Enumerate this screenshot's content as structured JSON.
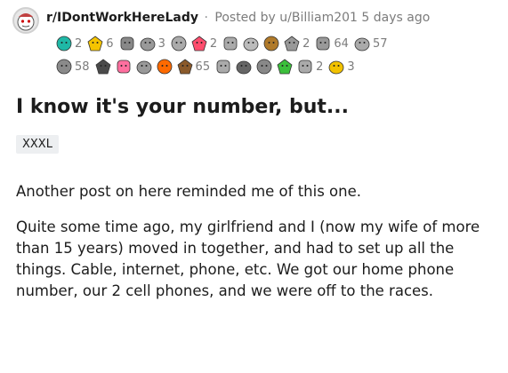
{
  "post": {
    "subreddit": "r/IDontWorkHereLady",
    "separator": "·",
    "posted_by": "Posted by u/Billiam201 5 days ago",
    "title": "I know it's your number, but...",
    "flair": "XXXL",
    "paragraphs": [
      "Another post on here reminded me of this one.",
      "Quite some time ago, my girlfriend and I (now my wife of more than 15 years) moved in together, and had to set up all the things. Cable, internet, phone, etc. We got our home phone number, our 2 cell phones, and we were off to the races."
    ]
  },
  "awards": {
    "row1": [
      {
        "icon": "helpful-award-icon",
        "color": "#1fb8a6",
        "count": "2"
      },
      {
        "icon": "wholesome-award-icon",
        "color": "#f5c400",
        "count": "6"
      },
      {
        "icon": "bravo-award-icon",
        "color": "#888888",
        "count": ""
      },
      {
        "icon": "laughing-face-award-icon",
        "color": "#999999",
        "count": "3"
      },
      {
        "icon": "handshake-award-icon",
        "color": "#aaaaaa",
        "count": ""
      },
      {
        "icon": "heart-eyes-award-icon",
        "color": "#ff4d6d",
        "count": "2"
      },
      {
        "icon": "hand-wave-award-icon",
        "color": "#aaaaaa",
        "count": ""
      },
      {
        "icon": "skull-award-icon",
        "color": "#bbbbbb",
        "count": ""
      },
      {
        "icon": "burger-award-icon",
        "color": "#b07a2a",
        "count": ""
      },
      {
        "icon": "facepalm-award-icon",
        "color": "#999999",
        "count": "2"
      },
      {
        "icon": "brain-award-icon",
        "color": "#999999",
        "count": "64"
      },
      {
        "icon": "snoo-face-award-icon",
        "color": "#aaaaaa",
        "count": "57"
      }
    ],
    "row2": [
      {
        "icon": "silver-award-icon",
        "color": "#8a8a8a",
        "count": "58"
      },
      {
        "icon": "framed-award-icon",
        "color": "#4a4a4a",
        "count": ""
      },
      {
        "icon": "love-award-icon",
        "color": "#ff6f9f",
        "count": ""
      },
      {
        "icon": "happy-face-award-icon",
        "color": "#999999",
        "count": ""
      },
      {
        "icon": "fire-award-icon",
        "color": "#ff6a00",
        "count": ""
      },
      {
        "icon": "bear-award-icon",
        "color": "#8a5a2b",
        "count": "65"
      },
      {
        "icon": "crying-face-award-icon",
        "color": "#aaaaaa",
        "count": ""
      },
      {
        "icon": "wizard-award-icon",
        "color": "#666666",
        "count": ""
      },
      {
        "icon": "alien-award-icon",
        "color": "#888888",
        "count": ""
      },
      {
        "icon": "dino-award-icon",
        "color": "#3cbf3c",
        "count": ""
      },
      {
        "icon": "salute-award-icon",
        "color": "#aaaaaa",
        "count": "2"
      },
      {
        "icon": "triangle-award-icon",
        "color": "#f2c200",
        "count": "3"
      }
    ]
  }
}
